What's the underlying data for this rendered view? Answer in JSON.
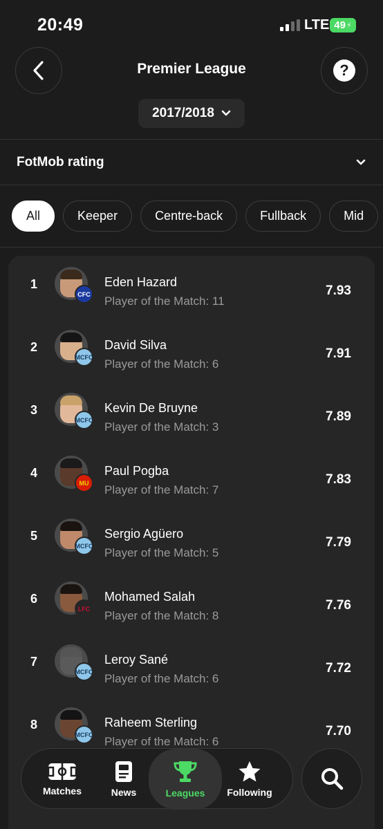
{
  "status_bar": {
    "time": "20:49",
    "network": "LTE",
    "battery": "49"
  },
  "header": {
    "title": "Premier League",
    "season": "2017/2018"
  },
  "stat_selector": {
    "label": "FotMob rating"
  },
  "filters": [
    {
      "label": "All",
      "active": true
    },
    {
      "label": "Keeper",
      "active": false
    },
    {
      "label": "Centre-back",
      "active": false
    },
    {
      "label": "Fullback",
      "active": false
    },
    {
      "label": "Mid",
      "active": false
    }
  ],
  "players": [
    {
      "rank": "1",
      "name": "Eden Hazard",
      "potm": "Player of the Match: 11",
      "rating": "7.93",
      "club": "chelsea"
    },
    {
      "rank": "2",
      "name": "David Silva",
      "potm": "Player of the Match: 6",
      "rating": "7.91",
      "club": "man-city"
    },
    {
      "rank": "3",
      "name": "Kevin De Bruyne",
      "potm": "Player of the Match: 3",
      "rating": "7.89",
      "club": "man-city"
    },
    {
      "rank": "4",
      "name": "Paul Pogba",
      "potm": "Player of the Match: 7",
      "rating": "7.83",
      "club": "man-utd"
    },
    {
      "rank": "5",
      "name": "Sergio Agüero",
      "potm": "Player of the Match: 5",
      "rating": "7.79",
      "club": "man-city"
    },
    {
      "rank": "6",
      "name": "Mohamed Salah",
      "potm": "Player of the Match: 8",
      "rating": "7.76",
      "club": "liverpool"
    },
    {
      "rank": "7",
      "name": "Leroy Sané",
      "potm": "Player of the Match: 6",
      "rating": "7.72",
      "club": "man-city"
    },
    {
      "rank": "8",
      "name": "Raheem Sterling",
      "potm": "Player of the Match: 6",
      "rating": "7.70",
      "club": "man-city"
    }
  ],
  "nav": {
    "matches": "Matches",
    "news": "News",
    "leagues": "Leagues",
    "following": "Following"
  },
  "colors": {
    "background": "#1c1c1c",
    "card": "#262626",
    "accent": "#4cd964",
    "secondary_text": "#9a9a9a"
  }
}
